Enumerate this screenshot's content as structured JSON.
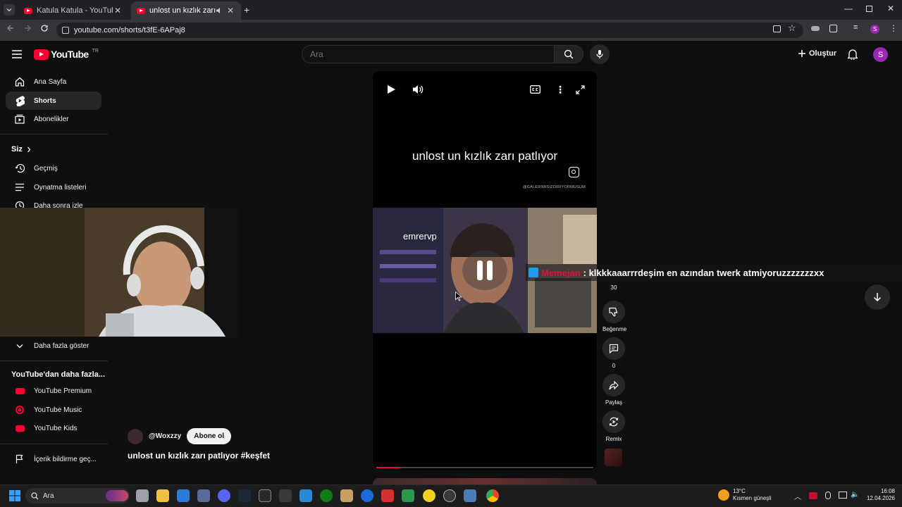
{
  "browser": {
    "tabs": [
      {
        "title": "Katula Katula - YouTube",
        "active": false
      },
      {
        "title": "unlost un kızlık zarı patlıyor",
        "active": true
      }
    ],
    "url": "youtube.com/shorts/t3fE-6APaj8",
    "profile_initial": "S"
  },
  "header": {
    "logo_text": "YouTube",
    "region": "TR",
    "search_placeholder": "Ara",
    "create_label": "Oluştur",
    "avatar_initial": "S"
  },
  "sidebar": {
    "main": [
      {
        "label": "Ana Sayfa",
        "icon": "home-icon"
      },
      {
        "label": "Shorts",
        "icon": "shorts-icon",
        "active": true
      },
      {
        "label": "Abonelikler",
        "icon": "subscriptions-icon"
      }
    ],
    "you_heading": "Siz",
    "you": [
      {
        "label": "Geçmiş",
        "icon": "history-icon"
      },
      {
        "label": "Oynatma listeleri",
        "icon": "playlists-icon"
      },
      {
        "label": "Daha sonra izle",
        "icon": "watch-later-icon"
      }
    ],
    "show_more": "Daha fazla göster",
    "more_heading": "YouTube'dan daha fazla...",
    "more": [
      {
        "label": "YouTube Premium"
      },
      {
        "label": "YouTube Music"
      },
      {
        "label": "YouTube Kids"
      }
    ],
    "report": "İçerik bildirme geç..."
  },
  "short": {
    "overlay_caption": "unlost un kızlık zarı patlıyor",
    "watermark": "@GALERIMISIZDIRIYORMUSUM",
    "clip_label": "emrervp",
    "progress_fraction": 0.11,
    "channel": "@Woxzzy",
    "subscribe_label": "Abone ol",
    "title": "unlost un kızlık zarı patlıyor #keşfet"
  },
  "actions": {
    "like_count": "30",
    "dislike_label": "Beğenme",
    "comment_count": "0",
    "share_label": "Paylaş",
    "remix_label": "Remix"
  },
  "chat_overlay": {
    "username": "Memejan",
    "message": ": klkkkaaarrrdeşim en azından twerk atmiyoruzzzzzzzxx",
    "username_color": "#e0103a"
  },
  "taskbar": {
    "search_placeholder": "Ara",
    "weather_temp": "13°C",
    "weather_desc": "Kısmen güneşli",
    "time": "16:08",
    "date": "12.04.2026"
  },
  "colors": {
    "background": "#0f0f0f",
    "youtube_red": "#ff0033",
    "avatar_purple": "#9c27b0"
  }
}
